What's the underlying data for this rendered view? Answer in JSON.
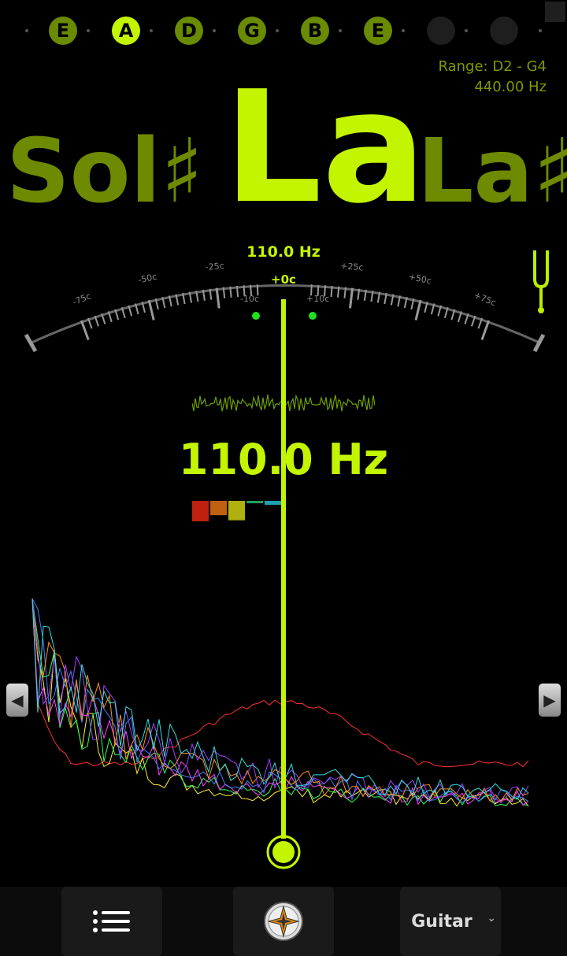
{
  "strings": [
    {
      "label": "E",
      "active": false,
      "color": "#6a8a00"
    },
    {
      "label": "A",
      "active": true,
      "color": "#c4f500"
    },
    {
      "label": "D",
      "active": false,
      "color": "#6a8a00"
    },
    {
      "label": "G",
      "active": false,
      "color": "#6a8a00"
    },
    {
      "label": "B",
      "active": false,
      "color": "#6a8a00"
    },
    {
      "label": "E",
      "active": false,
      "color": "#6a8a00"
    },
    {
      "label": "",
      "active": false,
      "color": "#1e1e1e"
    },
    {
      "label": "",
      "active": false,
      "color": "#1e1e1e"
    }
  ],
  "range": {
    "text": "Range: D2 - G4",
    "reference": "440.00 Hz"
  },
  "notes": {
    "prev": "Sol♯",
    "current": "La",
    "next": "La♯"
  },
  "meter": {
    "top_freq": "110.0 Hz",
    "cents": "+0c",
    "labels": {
      "m75": "-75c",
      "m50": "-50c",
      "m25": "-25c",
      "m10": "-10c",
      "p10": "+10c",
      "p25": "+25c",
      "p50": "+50c",
      "p75": "+75c"
    },
    "needle_cents": 0
  },
  "frequency": "110.0 Hz",
  "levels": {
    "colors": [
      "#c02010",
      "#c06010",
      "#b0b010",
      "#20a060",
      "#20a0b0"
    ],
    "values": [
      1.0,
      0.7,
      0.95,
      0.12,
      0.2
    ]
  },
  "bottom": {
    "menu_icon": "menu-list-icon",
    "compass_icon": "compass-icon",
    "instrument": "Guitar",
    "dropdown_icon": "chevron-down-icon"
  },
  "colors": {
    "accent": "#c4f500",
    "dim": "#6d8a00"
  }
}
